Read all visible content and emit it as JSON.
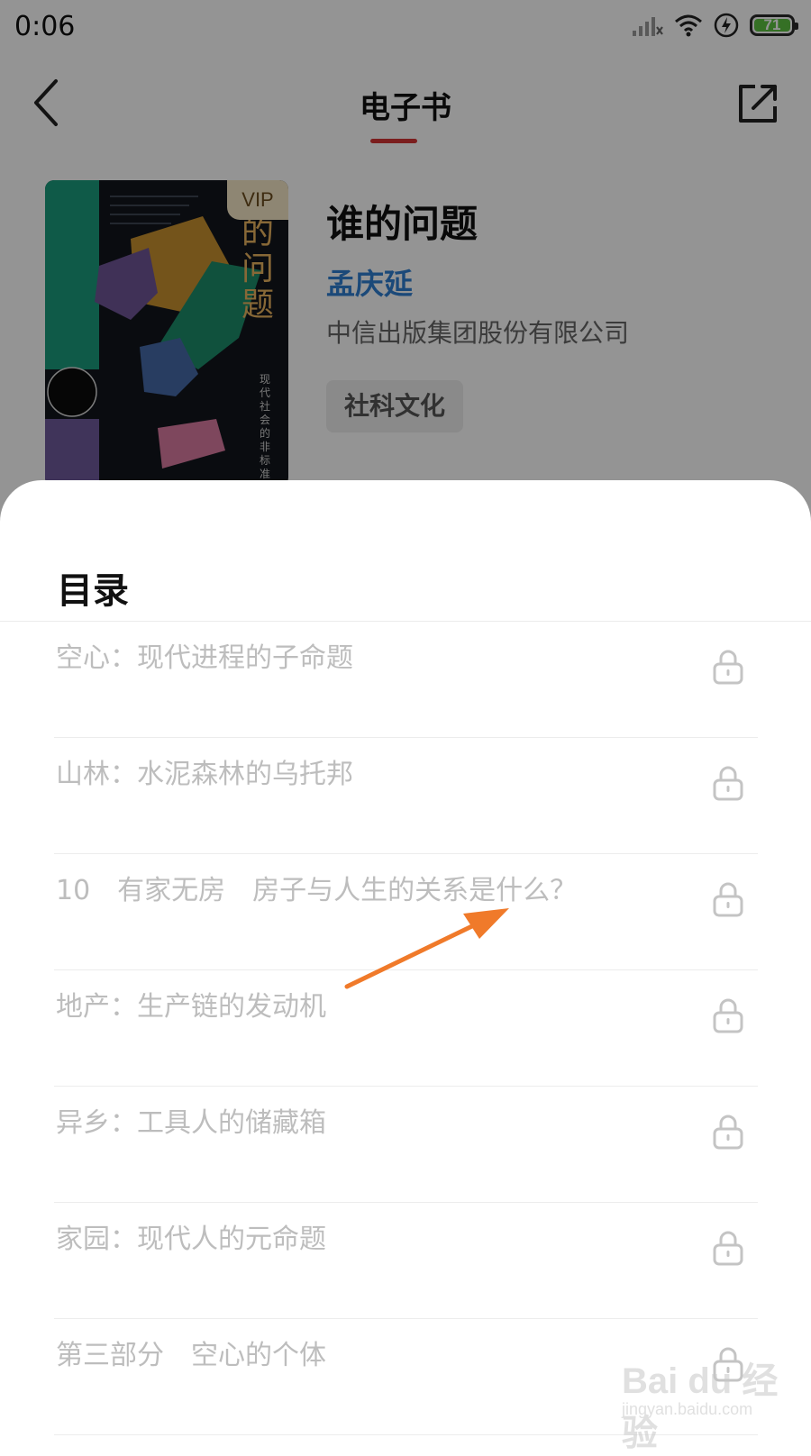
{
  "status_bar": {
    "time": "0:06",
    "battery_level": "71",
    "battery_color": "#5cc241"
  },
  "header": {
    "title": "电子书",
    "accent_color": "#d43535"
  },
  "book": {
    "cover_badge": "VIP",
    "title": "谁的问题",
    "author": "孟庆延",
    "publisher": "中信出版集团股份有限公司",
    "tag": "社科文化",
    "author_color": "#2f7fd1"
  },
  "toc": {
    "title": "目录",
    "items": [
      {
        "label": "空心：现代进程的子命题",
        "locked": true
      },
      {
        "label": "山林：水泥森林的乌托邦",
        "locked": true
      },
      {
        "label": "10　有家无房　房子与人生的关系是什么？",
        "locked": true
      },
      {
        "label": "地产：生产链的发动机",
        "locked": true
      },
      {
        "label": "异乡：工具人的储藏箱",
        "locked": true
      },
      {
        "label": "家园：现代人的元命题",
        "locked": true
      },
      {
        "label": "第三部分　空心的个体",
        "locked": true
      }
    ]
  },
  "annotation": {
    "arrow_color": "#f07a2a"
  },
  "watermark": {
    "main": "Bai du 经验",
    "sub": "jingyan.baidu.com"
  }
}
